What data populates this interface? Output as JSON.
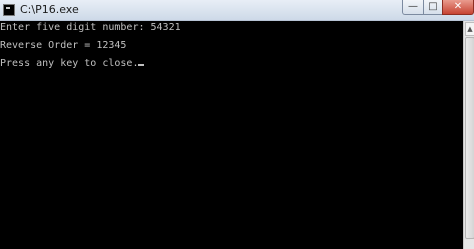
{
  "window": {
    "title": "C:\\P16.exe",
    "icon": "console-icon",
    "controls": {
      "minimize_icon": "minimize-icon",
      "minimize_glyph": "—",
      "maximize_icon": "maximize-icon",
      "maximize_glyph": "□",
      "close_icon": "close-icon",
      "close_glyph": "✕"
    }
  },
  "console": {
    "lines": [
      "Enter five digit number: 54321",
      "Reverse Order = 12345",
      "Press any key to close."
    ],
    "text_color": "#c0c0c0",
    "background": "#000000"
  },
  "scrollbar": {
    "up_arrow_glyph": "▲"
  }
}
